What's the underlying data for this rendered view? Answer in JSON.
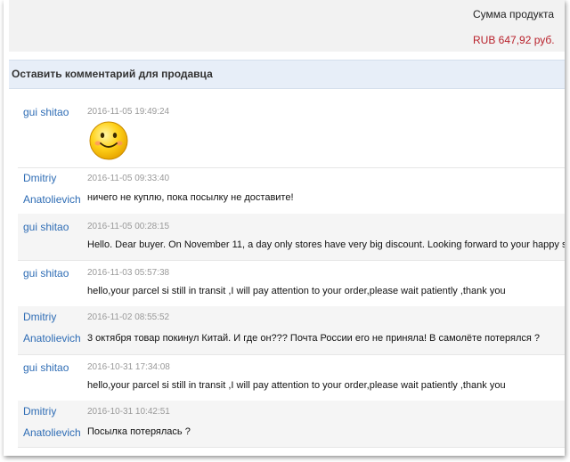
{
  "summary": {
    "label": "Сумма продукта",
    "total": "RUB 647,92 руб."
  },
  "section": {
    "title": "Оставить комментарий для продавца"
  },
  "comments": [
    {
      "author": "gui shitao",
      "date": "2016-11-05 19:49:24",
      "message": "",
      "sticker": "smiley-face-icon"
    },
    {
      "author": "Dmitriy Anatolievich",
      "date": "2016-11-05 09:33:40",
      "message": "ничего не куплю, пока посылку не доставите!"
    },
    {
      "author": "gui shitao",
      "date": "2016-11-05 00:28:15",
      "message": "Hello. Dear buyer. On November 11, a day only stores have very big discount. Looking forward to your happy shopping"
    },
    {
      "author": "gui shitao",
      "date": "2016-11-03 05:57:38",
      "message": "hello,your parcel si still in transit ,I will pay attention to your order,please wait patiently ,thank you"
    },
    {
      "author": "Dmitriy Anatolievich",
      "date": "2016-11-02 08:55:52",
      "message": "3 октября товар покинул Китай. И где он??? Почта России его не приняла! В самолёте потерялся ?"
    },
    {
      "author": "gui shitao",
      "date": "2016-10-31 17:34:08",
      "message": "hello,your parcel si still in transit ,I will pay attention to your order,please wait patiently ,thank you"
    },
    {
      "author": "Dmitriy Anatolievich",
      "date": "2016-10-31 10:42:51",
      "message": "Посылка потерялась ?"
    }
  ],
  "colors": {
    "author_link": "#2f6db5",
    "price": "#b8202a",
    "header_bg": "#e7eef8"
  }
}
